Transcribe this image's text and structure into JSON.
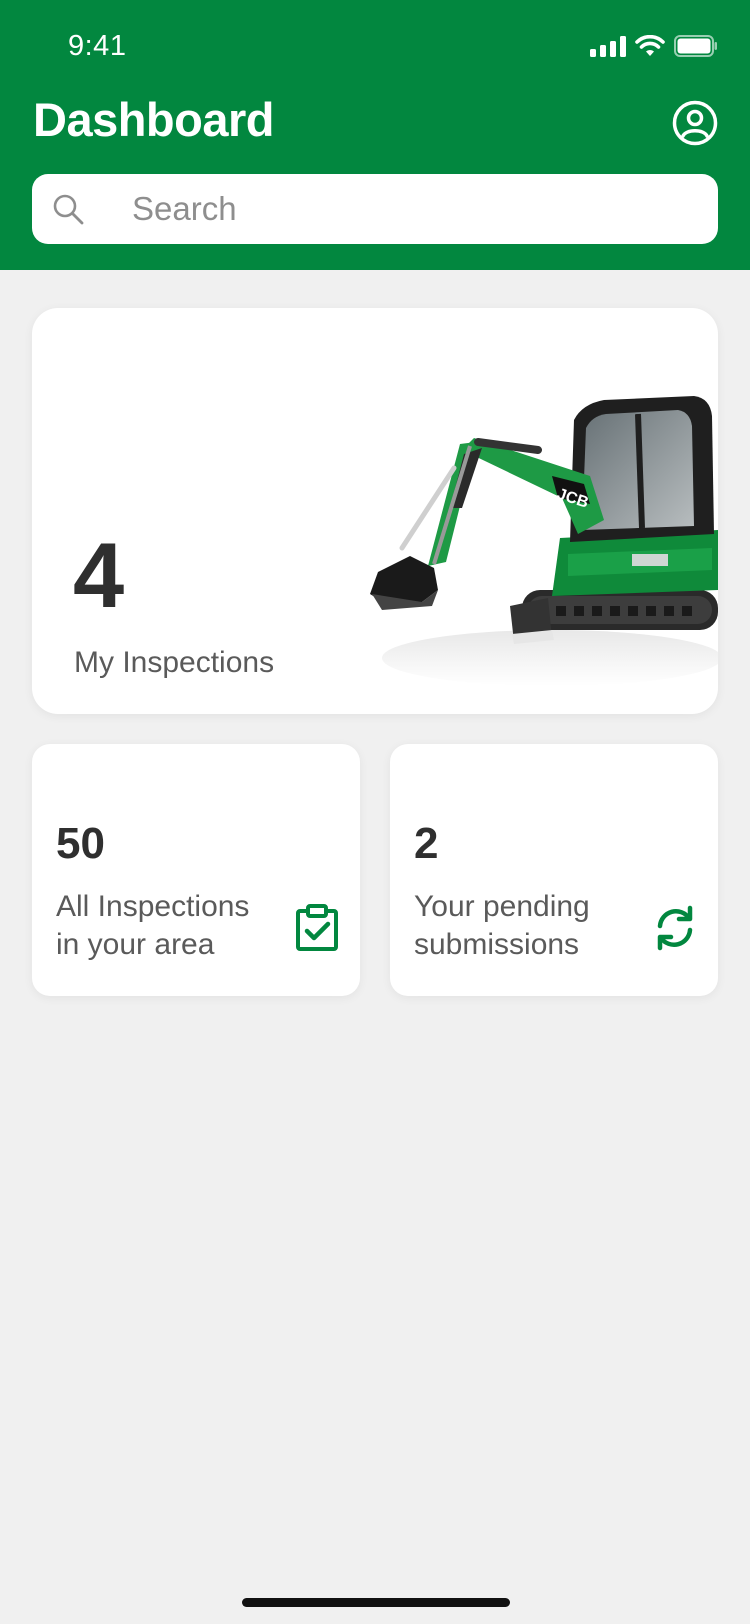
{
  "status_bar": {
    "time": "9:41"
  },
  "header": {
    "title": "Dashboard",
    "search_placeholder": "Search",
    "search_value": ""
  },
  "cards": {
    "my_inspections": {
      "count": "4",
      "label": "My Inspections"
    },
    "all_inspections": {
      "count": "50",
      "label_line1": "All Inspections",
      "label_line2": "in your area"
    },
    "pending": {
      "count": "2",
      "label_line1": "Your pending",
      "label_line2": "submissions"
    }
  },
  "icons": {
    "profile": "user-circle-icon",
    "search": "search-icon",
    "clipboard": "clipboard-check-icon",
    "sync": "sync-icon"
  },
  "colors": {
    "brand": "#02873f",
    "background": "#f0f0f0",
    "card": "#ffffff",
    "text": "#2f2f2f"
  }
}
